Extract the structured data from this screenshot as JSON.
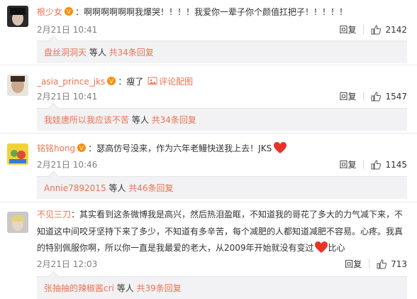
{
  "comments": [
    {
      "user": "根少女",
      "text": "啊啊啊啊啊啊我爆哭！！！！我爱你一辈子你个颜值扛把子！！！！！",
      "time": "2月21日 10:41",
      "reply_label": "回复",
      "likes": "2142",
      "replies": {
        "user": "盘丝洞洞天",
        "middle": " 等人 ",
        "count": "共34条回复"
      }
    },
    {
      "user": "_asia_prince_jks",
      "text": "瘦了",
      "image_link": "评论配图",
      "time": "2月21日 10:41",
      "reply_label": "回复",
      "likes": "1547",
      "replies": {
        "user": "我娃唐所以我应该不苦",
        "middle": " 等人 ",
        "count": "共34条回复"
      }
    },
    {
      "user": "铭铭hong",
      "text": "：瑟高仿号没来，作为六年老鳗快送我上去！JKS",
      "time": "2月21日 10:46",
      "reply_label": "回复",
      "likes": "1145",
      "replies": {
        "user": "Annie7892015",
        "middle": " 等人 ",
        "count": "共46条回复"
      }
    },
    {
      "user": "不见三刀",
      "line1": "：其实看到这条微博我是高兴，然后热泪盈眶，不知道我的哥花了多大的力气减下来，不",
      "line2": "知道这中间咬牙坚持下来了多少，不知道有多辛苦，每个减肥的人都知道减肥不容易。心疼。我真",
      "line3": "的特别佩服你啊，所以你一直是我最爱的老大，从2009年开始就没有变过",
      "line3_tail": "比心",
      "time": "2月21日 12:03",
      "reply_label": "回复",
      "likes": "713",
      "replies": {
        "user": "张抽抽的辣椒酱cri",
        "middle": " 等人 ",
        "count": "共39条回复"
      }
    }
  ],
  "colors": {
    "link": "#eb7350",
    "muted": "#808080",
    "reply_bg": "#f2f2f5"
  }
}
